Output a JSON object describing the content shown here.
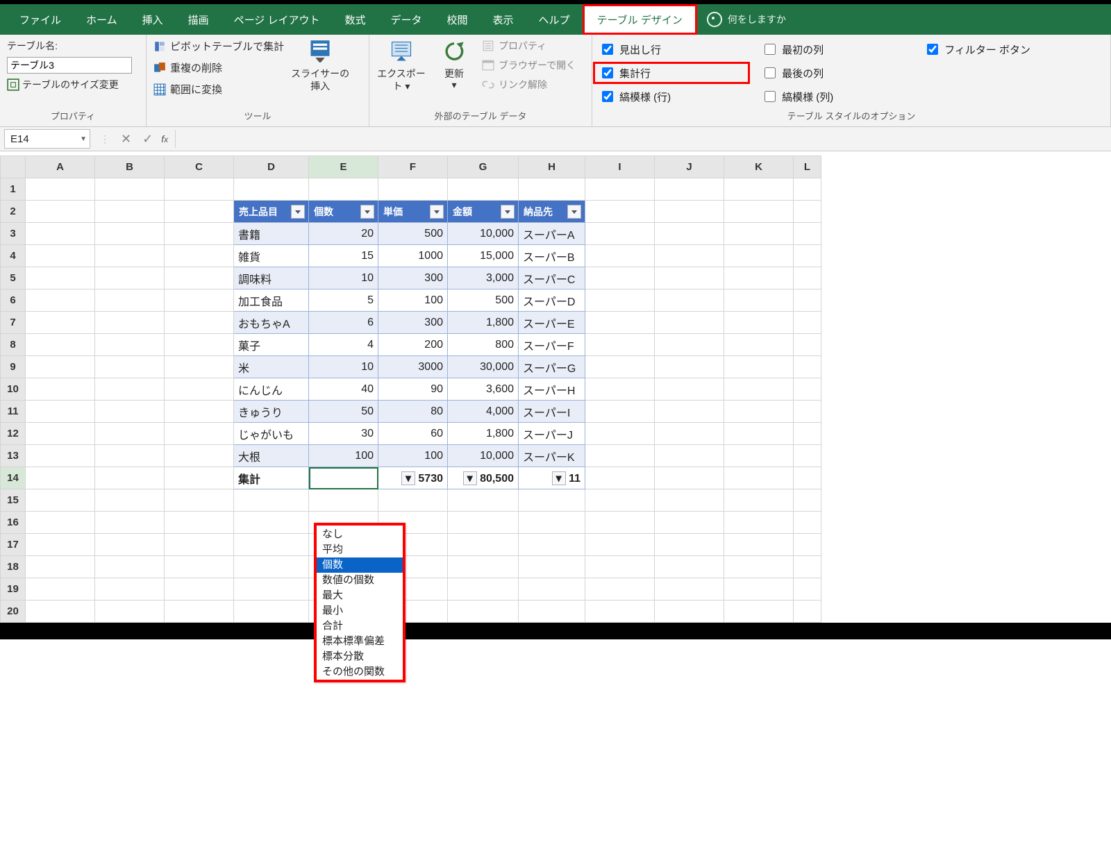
{
  "tabs": {
    "file": "ファイル",
    "home": "ホーム",
    "insert": "挿入",
    "draw": "描画",
    "layout": "ページ レイアウト",
    "formulas": "数式",
    "data": "データ",
    "review": "校閲",
    "view": "表示",
    "help": "ヘルプ",
    "table_design": "テーブル デザイン",
    "tell_me": "何をしますか"
  },
  "ribbon": {
    "properties": {
      "label": "プロパティ",
      "table_name_label": "テーブル名:",
      "table_name_value": "テーブル3",
      "resize": "テーブルのサイズ変更"
    },
    "tools": {
      "label": "ツール",
      "pivot": "ピボットテーブルで集計",
      "dedup": "重複の削除",
      "convert": "範囲に変換",
      "slicer_l1": "スライサーの",
      "slicer_l2": "挿入"
    },
    "external": {
      "label": "外部のテーブル データ",
      "export_l1": "エクスポー",
      "export_l2": "ト",
      "refresh": "更新",
      "props": "プロパティ",
      "open_browser": "ブラウザーで開く",
      "unlink": "リンク解除"
    },
    "options": {
      "label": "テーブル スタイルのオプション",
      "header_row": "見出し行",
      "first_col": "最初の列",
      "filter_btn": "フィルター ボタン",
      "total_row": "集計行",
      "last_col": "最後の列",
      "banded_rows": "縞模様 (行)",
      "banded_cols": "縞模様 (列)"
    }
  },
  "fbar": {
    "namebox": "E14"
  },
  "columns": [
    "A",
    "B",
    "C",
    "D",
    "E",
    "F",
    "G",
    "H",
    "I",
    "J",
    "K",
    "L"
  ],
  "rows": [
    "1",
    "2",
    "3",
    "4",
    "5",
    "6",
    "7",
    "8",
    "9",
    "10",
    "11",
    "12",
    "13",
    "14",
    "15",
    "16",
    "17",
    "18",
    "19",
    "20"
  ],
  "table": {
    "headers": {
      "d": "売上品目",
      "e": "個数",
      "f": "単価",
      "g": "金額",
      "h": "納品先"
    },
    "rows": [
      {
        "d": "書籍",
        "e": "20",
        "f": "500",
        "g": "10,000",
        "h": "スーパーA"
      },
      {
        "d": "雑貨",
        "e": "15",
        "f": "1000",
        "g": "15,000",
        "h": "スーパーB"
      },
      {
        "d": "調味料",
        "e": "10",
        "f": "300",
        "g": "3,000",
        "h": "スーパーC"
      },
      {
        "d": "加工食品",
        "e": "5",
        "f": "100",
        "g": "500",
        "h": "スーパーD"
      },
      {
        "d": "おもちゃA",
        "e": "6",
        "f": "300",
        "g": "1,800",
        "h": "スーパーE"
      },
      {
        "d": "菓子",
        "e": "4",
        "f": "200",
        "g": "800",
        "h": "スーパーF"
      },
      {
        "d": "米",
        "e": "10",
        "f": "3000",
        "g": "30,000",
        "h": "スーパーG"
      },
      {
        "d": "にんじん",
        "e": "40",
        "f": "90",
        "g": "3,600",
        "h": "スーパーH"
      },
      {
        "d": "きゅうり",
        "e": "50",
        "f": "80",
        "g": "4,000",
        "h": "スーパーI"
      },
      {
        "d": "じゃがいも",
        "e": "30",
        "f": "60",
        "g": "1,800",
        "h": "スーパーJ"
      },
      {
        "d": "大根",
        "e": "100",
        "f": "100",
        "g": "10,000",
        "h": "スーパーK"
      }
    ],
    "totals": {
      "d": "集計",
      "f": "5730",
      "g": "80,500",
      "h": "11"
    }
  },
  "dropdown": {
    "items": [
      "なし",
      "平均",
      "個数",
      "数値の個数",
      "最大",
      "最小",
      "合計",
      "標本標準偏差",
      "標本分散",
      "その他の関数"
    ],
    "selected_index": 2
  }
}
